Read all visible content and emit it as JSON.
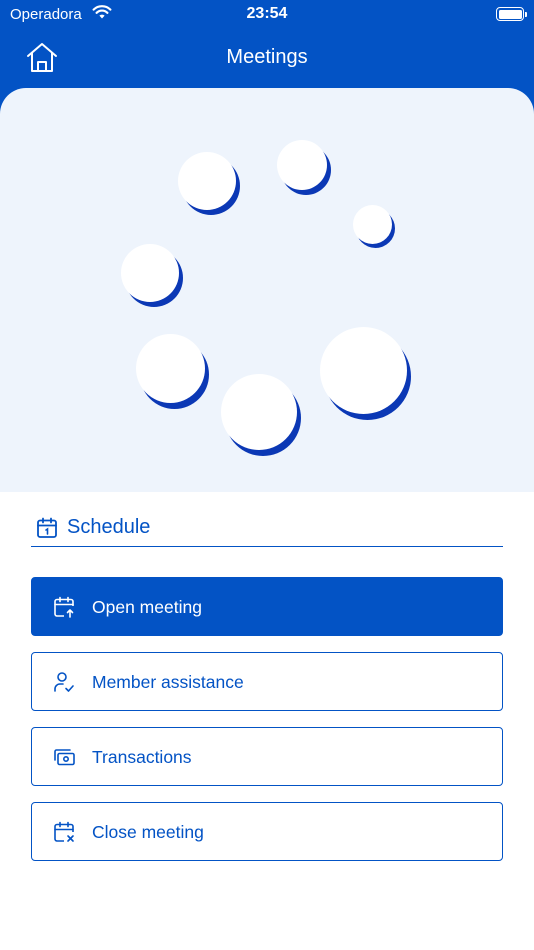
{
  "status_bar": {
    "carrier": "Operadora",
    "time": "23:54"
  },
  "header": {
    "title": "Meetings",
    "home_icon": "home-icon"
  },
  "colors": {
    "primary": "#0353c5",
    "hero_bg": "#eef4fc",
    "dot_shadow": "#0b38b5"
  },
  "section": {
    "label": "Schedule",
    "icon": "calendar-icon"
  },
  "actions": [
    {
      "label": "Open meeting",
      "icon": "calendar-arrow-up-icon",
      "selected": true
    },
    {
      "label": "Member assistance",
      "icon": "user-check-icon",
      "selected": false
    },
    {
      "label": "Transactions",
      "icon": "cash-icon",
      "selected": false
    },
    {
      "label": "Close meeting",
      "icon": "calendar-x-icon",
      "selected": false
    }
  ]
}
